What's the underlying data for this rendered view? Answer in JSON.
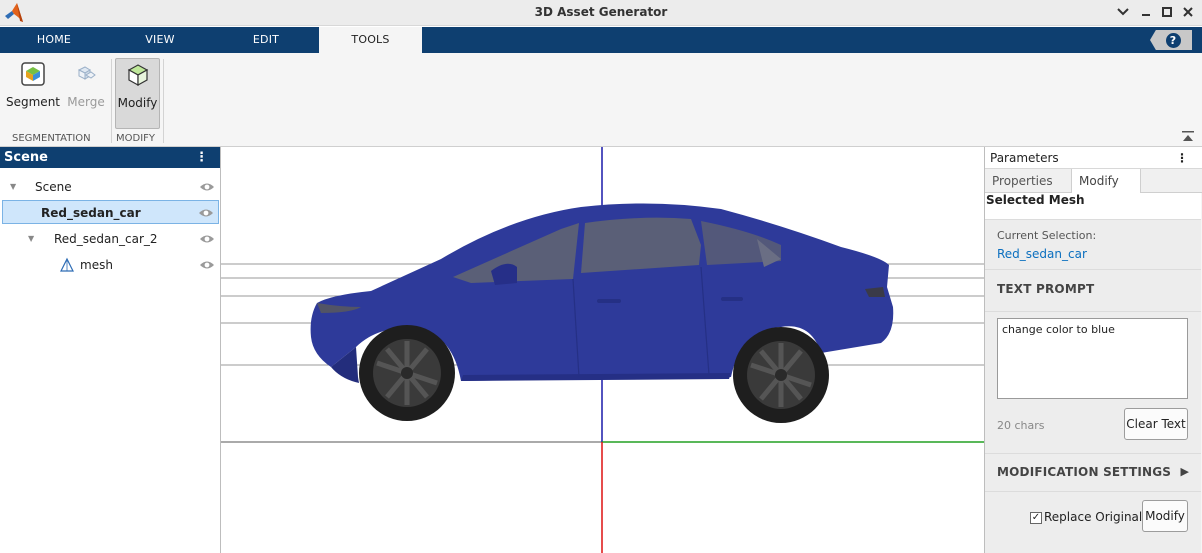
{
  "window": {
    "title": "3D Asset Generator",
    "controls": {
      "chevron": "chevron-down-icon",
      "minimize": "minimize-icon",
      "maximize": "maximize-icon",
      "close": "close-icon"
    }
  },
  "ribbon": {
    "tabs": [
      {
        "label": "HOME"
      },
      {
        "label": "VIEW"
      },
      {
        "label": "EDIT"
      },
      {
        "label": "TOOLS",
        "active": true
      }
    ],
    "help_label": "?"
  },
  "toolstrip": {
    "groups": [
      {
        "label": "SEGMENTATION",
        "tools": [
          {
            "label": "Segment",
            "icon": "segment-icon"
          },
          {
            "label": "Merge",
            "icon": "merge-icon",
            "disabled": true
          }
        ]
      },
      {
        "label": "MODIFY",
        "tools": [
          {
            "label": "Modify",
            "icon": "modify-cube-icon",
            "pressed": true
          }
        ]
      }
    ]
  },
  "scene_panel": {
    "title": "Scene",
    "menu": "⋮",
    "tree": [
      {
        "label": "Scene",
        "level": 0,
        "expanded": true
      },
      {
        "label": "Red_sedan_car",
        "level": 1,
        "selected": true
      },
      {
        "label": "Red_sedan_car_2",
        "level": 1,
        "expanded": true
      },
      {
        "label": "mesh",
        "level": 2,
        "icon": "mesh-icon"
      }
    ]
  },
  "viewport": {
    "axis_colors": {
      "x": "#22a022",
      "y": "#dd1111",
      "z": "#1a1aaa"
    },
    "car_color": "#2e3a9a"
  },
  "parameters": {
    "title": "Parameters",
    "menu": "⋮",
    "tabs": [
      {
        "label": "Properties"
      },
      {
        "label": "Modify",
        "active": true
      }
    ],
    "selected_mesh": {
      "title": "Selected Mesh",
      "current_selection_label": "Current Selection:",
      "current_selection_value": "Red_sedan_car"
    },
    "text_prompt": {
      "header": "TEXT PROMPT",
      "value": "change color to blue",
      "char_count": "20 chars",
      "clear_label": "Clear Text"
    },
    "modification_settings": {
      "header": "MODIFICATION SETTINGS",
      "expand_glyph": "▶"
    },
    "footer": {
      "replace_original_label": "Replace Original",
      "replace_original_checked": true,
      "modify_label": "Modify"
    }
  }
}
